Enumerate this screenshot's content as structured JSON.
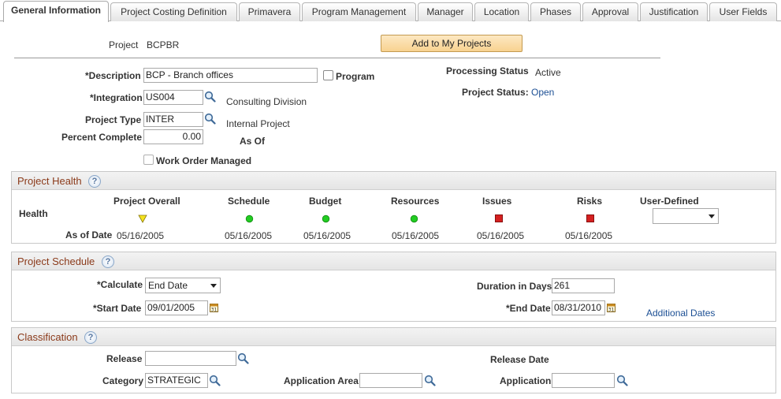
{
  "tabs": [
    {
      "label": "General Information",
      "active": true
    },
    {
      "label": "Project Costing Definition"
    },
    {
      "label": "Primavera"
    },
    {
      "label": "Program Management"
    },
    {
      "label": "Manager"
    },
    {
      "label": "Location"
    },
    {
      "label": "Phases"
    },
    {
      "label": "Approval"
    },
    {
      "label": "Justification"
    },
    {
      "label": "User Fields"
    }
  ],
  "header": {
    "project_label": "Project",
    "project_value": "BCPBR",
    "add_button": "Add to My Projects"
  },
  "general": {
    "description_label": "*Description",
    "description_value": "BCP - Branch offices",
    "program_label": "Program",
    "integration_label": "*Integration",
    "integration_value": "US004",
    "integration_desc": "Consulting Division",
    "project_type_label": "Project Type",
    "project_type_value": "INTER",
    "project_type_desc": "Internal Project",
    "percent_label": "Percent Complete",
    "percent_value": "0.00",
    "as_of_label": "As Of",
    "work_order_label": "Work Order Managed",
    "processing_status_label": "Processing Status",
    "processing_status_value": "Active",
    "project_status_label": "Project Status:",
    "project_status_value": "Open"
  },
  "health": {
    "title": "Project Health",
    "help": "?",
    "row_label": "Health",
    "as_of_label": "As of Date",
    "columns": [
      {
        "label": "Project Overall",
        "indicator": "yellow-triangle",
        "date": "05/16/2005"
      },
      {
        "label": "Schedule",
        "indicator": "green-circle",
        "date": "05/16/2005"
      },
      {
        "label": "Budget",
        "indicator": "green-circle",
        "date": "05/16/2005"
      },
      {
        "label": "Resources",
        "indicator": "green-circle",
        "date": "05/16/2005"
      },
      {
        "label": "Issues",
        "indicator": "red-square",
        "date": "05/16/2005"
      },
      {
        "label": "Risks",
        "indicator": "red-square",
        "date": "05/16/2005"
      }
    ],
    "user_defined_label": "User-Defined",
    "user_defined_value": "",
    "colors": {
      "green": "#22cc22",
      "red": "#d42020",
      "yellow": "#f4e21e"
    }
  },
  "schedule": {
    "title": "Project Schedule",
    "help": "?",
    "calculate_label": "*Calculate",
    "calculate_value": "End Date",
    "duration_label": "Duration in Days",
    "duration_value": "261",
    "start_label": "*Start Date",
    "start_value": "09/01/2005",
    "end_label": "*End Date",
    "end_value": "08/31/2010",
    "additional_dates": "Additional Dates"
  },
  "classification": {
    "title": "Classification",
    "help": "?",
    "release_label": "Release",
    "release_value": "",
    "release_date_label": "Release Date",
    "category_label": "Category",
    "category_value": "STRATEGIC",
    "app_area_label": "Application Area",
    "app_area_value": "",
    "application_label": "Application",
    "application_value": ""
  },
  "icons": {
    "lookup": "magnifier-icon",
    "calendar": "calendar-icon",
    "help": "help-icon"
  }
}
